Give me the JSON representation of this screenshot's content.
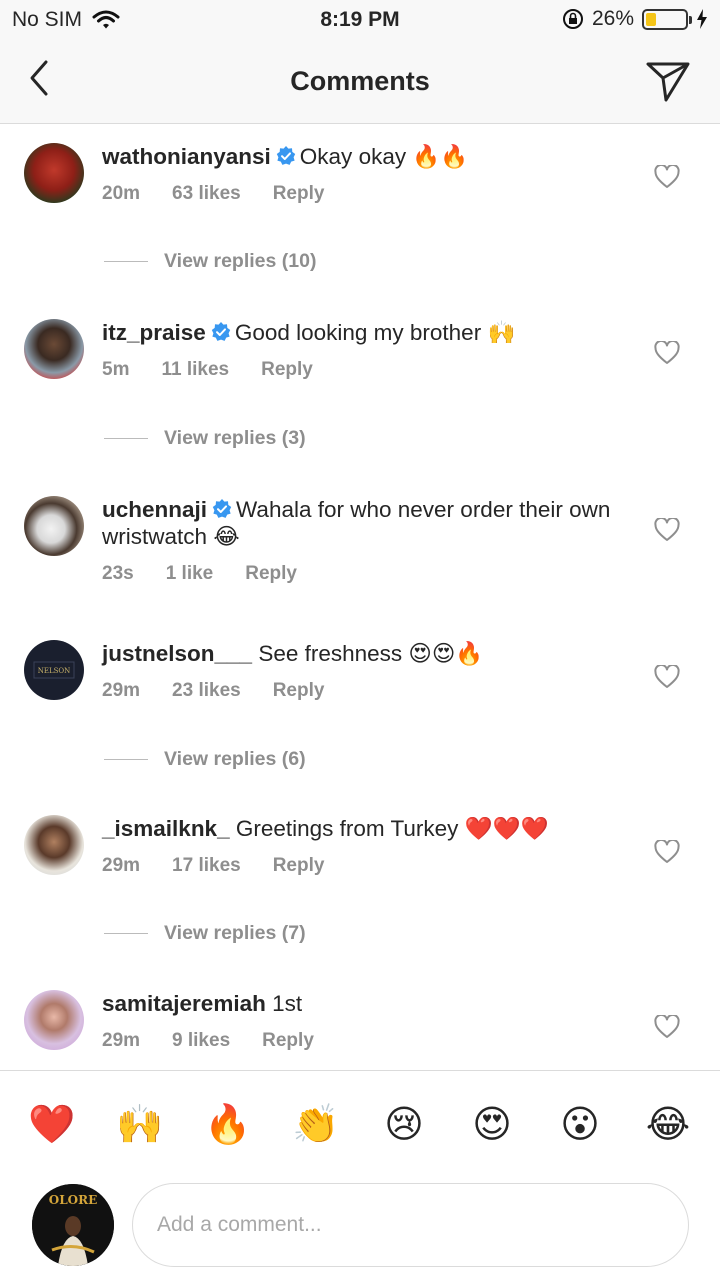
{
  "status_bar": {
    "carrier": "No SIM",
    "time": "8:19 PM",
    "battery_percent": "26%",
    "battery_level": 0.26
  },
  "header": {
    "title": "Comments"
  },
  "comments": [
    {
      "username": "wathonianyansi",
      "verified": true,
      "text": "Okay okay 🔥🔥",
      "time": "20m",
      "likes": "63 likes",
      "reply": "Reply",
      "view_replies": "View replies (10)"
    },
    {
      "username": "itz_praise",
      "verified": true,
      "text": "Good looking my brother 🙌",
      "time": "5m",
      "likes": "11 likes",
      "reply": "Reply",
      "view_replies": "View replies (3)"
    },
    {
      "username": "uchennaji",
      "verified": true,
      "text": "Wahala for  who never order their own wristwatch 😂",
      "time": "23s",
      "likes": "1 like",
      "reply": "Reply",
      "view_replies": ""
    },
    {
      "username": "justnelson___",
      "verified": false,
      "text": "See freshness 😍😍🔥",
      "time": "29m",
      "likes": "23 likes",
      "reply": "Reply",
      "view_replies": "View replies (6)"
    },
    {
      "username": "_ismailknk_",
      "verified": false,
      "text": "Greetings from Turkey ❤️❤️❤️",
      "time": "29m",
      "likes": "17 likes",
      "reply": "Reply",
      "view_replies": "View replies (7)"
    },
    {
      "username": "samitajeremiah",
      "verified": false,
      "text": "1st",
      "time": "29m",
      "likes": "9 likes",
      "reply": "Reply",
      "view_replies": ""
    }
  ],
  "quick_emojis": [
    "❤️",
    "🙌",
    "🔥",
    "👏",
    "😢",
    "😍",
    "😮",
    "😂"
  ],
  "composer": {
    "placeholder": "Add a comment...",
    "avatar_text": "OLORE"
  },
  "colors": {
    "verified": "#3897f0",
    "meta_gray": "#8e8e8e",
    "text": "#262626",
    "battery_fill": "#f5c518"
  }
}
